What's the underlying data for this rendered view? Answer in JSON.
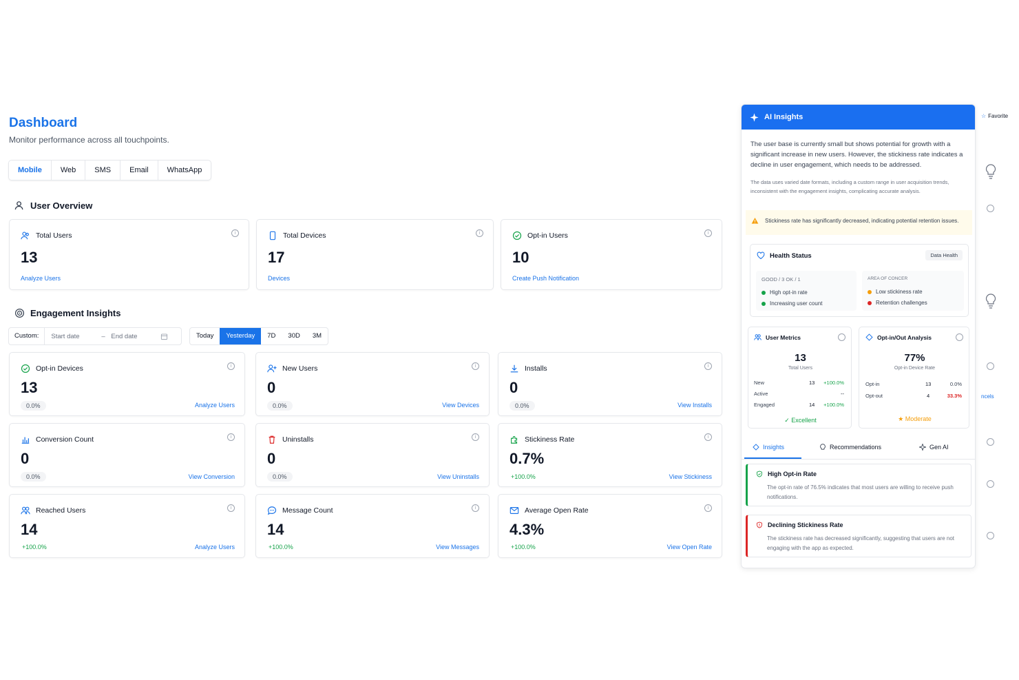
{
  "header": {
    "title": "Dashboard",
    "subtitle": "Monitor performance across all touchpoints."
  },
  "tabs": [
    {
      "label": "Mobile",
      "active": true
    },
    {
      "label": "Web"
    },
    {
      "label": "SMS"
    },
    {
      "label": "Email"
    },
    {
      "label": "WhatsApp"
    }
  ],
  "user_overview": {
    "title": "User Overview",
    "cards": [
      {
        "label": "Total Users",
        "value": "13",
        "link": "Analyze Users"
      },
      {
        "label": "Total Devices",
        "value": "17",
        "link": "Devices"
      },
      {
        "label": "Opt-in Users",
        "value": "10",
        "link": "Create Push Notification"
      }
    ]
  },
  "engagement": {
    "title": "Engagement Insights",
    "custom_label": "Custom:",
    "start_placeholder": "Start date",
    "end_placeholder": "End date",
    "periods": [
      "Today",
      "Yesterday",
      "7D",
      "30D",
      "3M"
    ],
    "active_period": "Yesterday",
    "cards": [
      {
        "label": "Opt-in Devices",
        "value": "13",
        "change": "0.0%",
        "link": "Analyze Users"
      },
      {
        "label": "New Users",
        "value": "0",
        "change": "0.0%",
        "link": "View Devices"
      },
      {
        "label": "Installs",
        "value": "0",
        "change": "0.0%",
        "link": "View Installs"
      },
      {
        "label": "Conversion Count",
        "value": "0",
        "change": "0.0%",
        "link": "View Conversion"
      },
      {
        "label": "Uninstalls",
        "value": "0",
        "change": "0.0%",
        "link": "View Uninstalls"
      },
      {
        "label": "Stickiness Rate",
        "value": "0.7%",
        "change": "+100.0%",
        "link": "View Stickiness"
      },
      {
        "label": "Reached Users",
        "value": "14",
        "change": "+100.0%",
        "link": "Analyze Users"
      },
      {
        "label": "Message Count",
        "value": "14",
        "change": "+100.0%",
        "link": "View Messages"
      },
      {
        "label": "Average Open Rate",
        "value": "4.3%",
        "change": "+100.0%",
        "link": "View Open Rate"
      }
    ]
  },
  "ai": {
    "title": "AI Insights",
    "summary": "The user base is currently small but shows potential for growth with a significant increase in new users. However, the stickiness rate indicates a decline in user engagement, which needs to be addressed.",
    "note": "The data uses varied date formats, including a custom range in user acquisition trends, inconsistent with the engagement insights, complicating accurate analysis.",
    "warning": "Stickiness rate has significantly decreased, indicating potential retention issues.",
    "health": {
      "title": "Health Status",
      "badge": "Data Health",
      "good_label": "GOOD / 3 OK / 1",
      "good_items": [
        "High opt-in rate",
        "Increasing user count"
      ],
      "concern_label": "AREA OF CONCER",
      "concern_items": [
        "Low stickiness rate",
        "Retention challenges"
      ]
    },
    "user_metrics": {
      "title": "User Metrics",
      "value": "13",
      "caption": "Total Users",
      "rows": [
        {
          "label": "New",
          "value": "13",
          "change": "+100.0%"
        },
        {
          "label": "Active",
          "value": "--",
          "change": ""
        },
        {
          "label": "Engaged",
          "value": "14",
          "change": "+100.0%"
        }
      ],
      "status": "Excellent"
    },
    "optin": {
      "title": "Opt-in/Out Analysis",
      "value": "77%",
      "caption": "Opt-in Device Rate",
      "rows": [
        {
          "label": "Opt-in",
          "value": "13",
          "change": "0.0%"
        },
        {
          "label": "Opt-out",
          "value": "4",
          "change": "33.3%"
        }
      ],
      "status": "Moderate"
    },
    "tabs": [
      "Insights",
      "Recommendations",
      "Gen AI"
    ],
    "insights": [
      {
        "title": "High Opt-in Rate",
        "text": "The opt-in rate of 76.5% indicates that most users are willing to receive push notifications."
      },
      {
        "title": "Declining Stickiness Rate",
        "text": "The stickiness rate has decreased significantly, suggesting that users are not engaging with the app as expected."
      }
    ]
  },
  "side": {
    "favorite": "Favorite",
    "cut_text": "ncels"
  },
  "colors": {
    "accent": "#1a73e8",
    "green": "#16a34a",
    "red": "#dc2626",
    "orange": "#f59e0b"
  }
}
